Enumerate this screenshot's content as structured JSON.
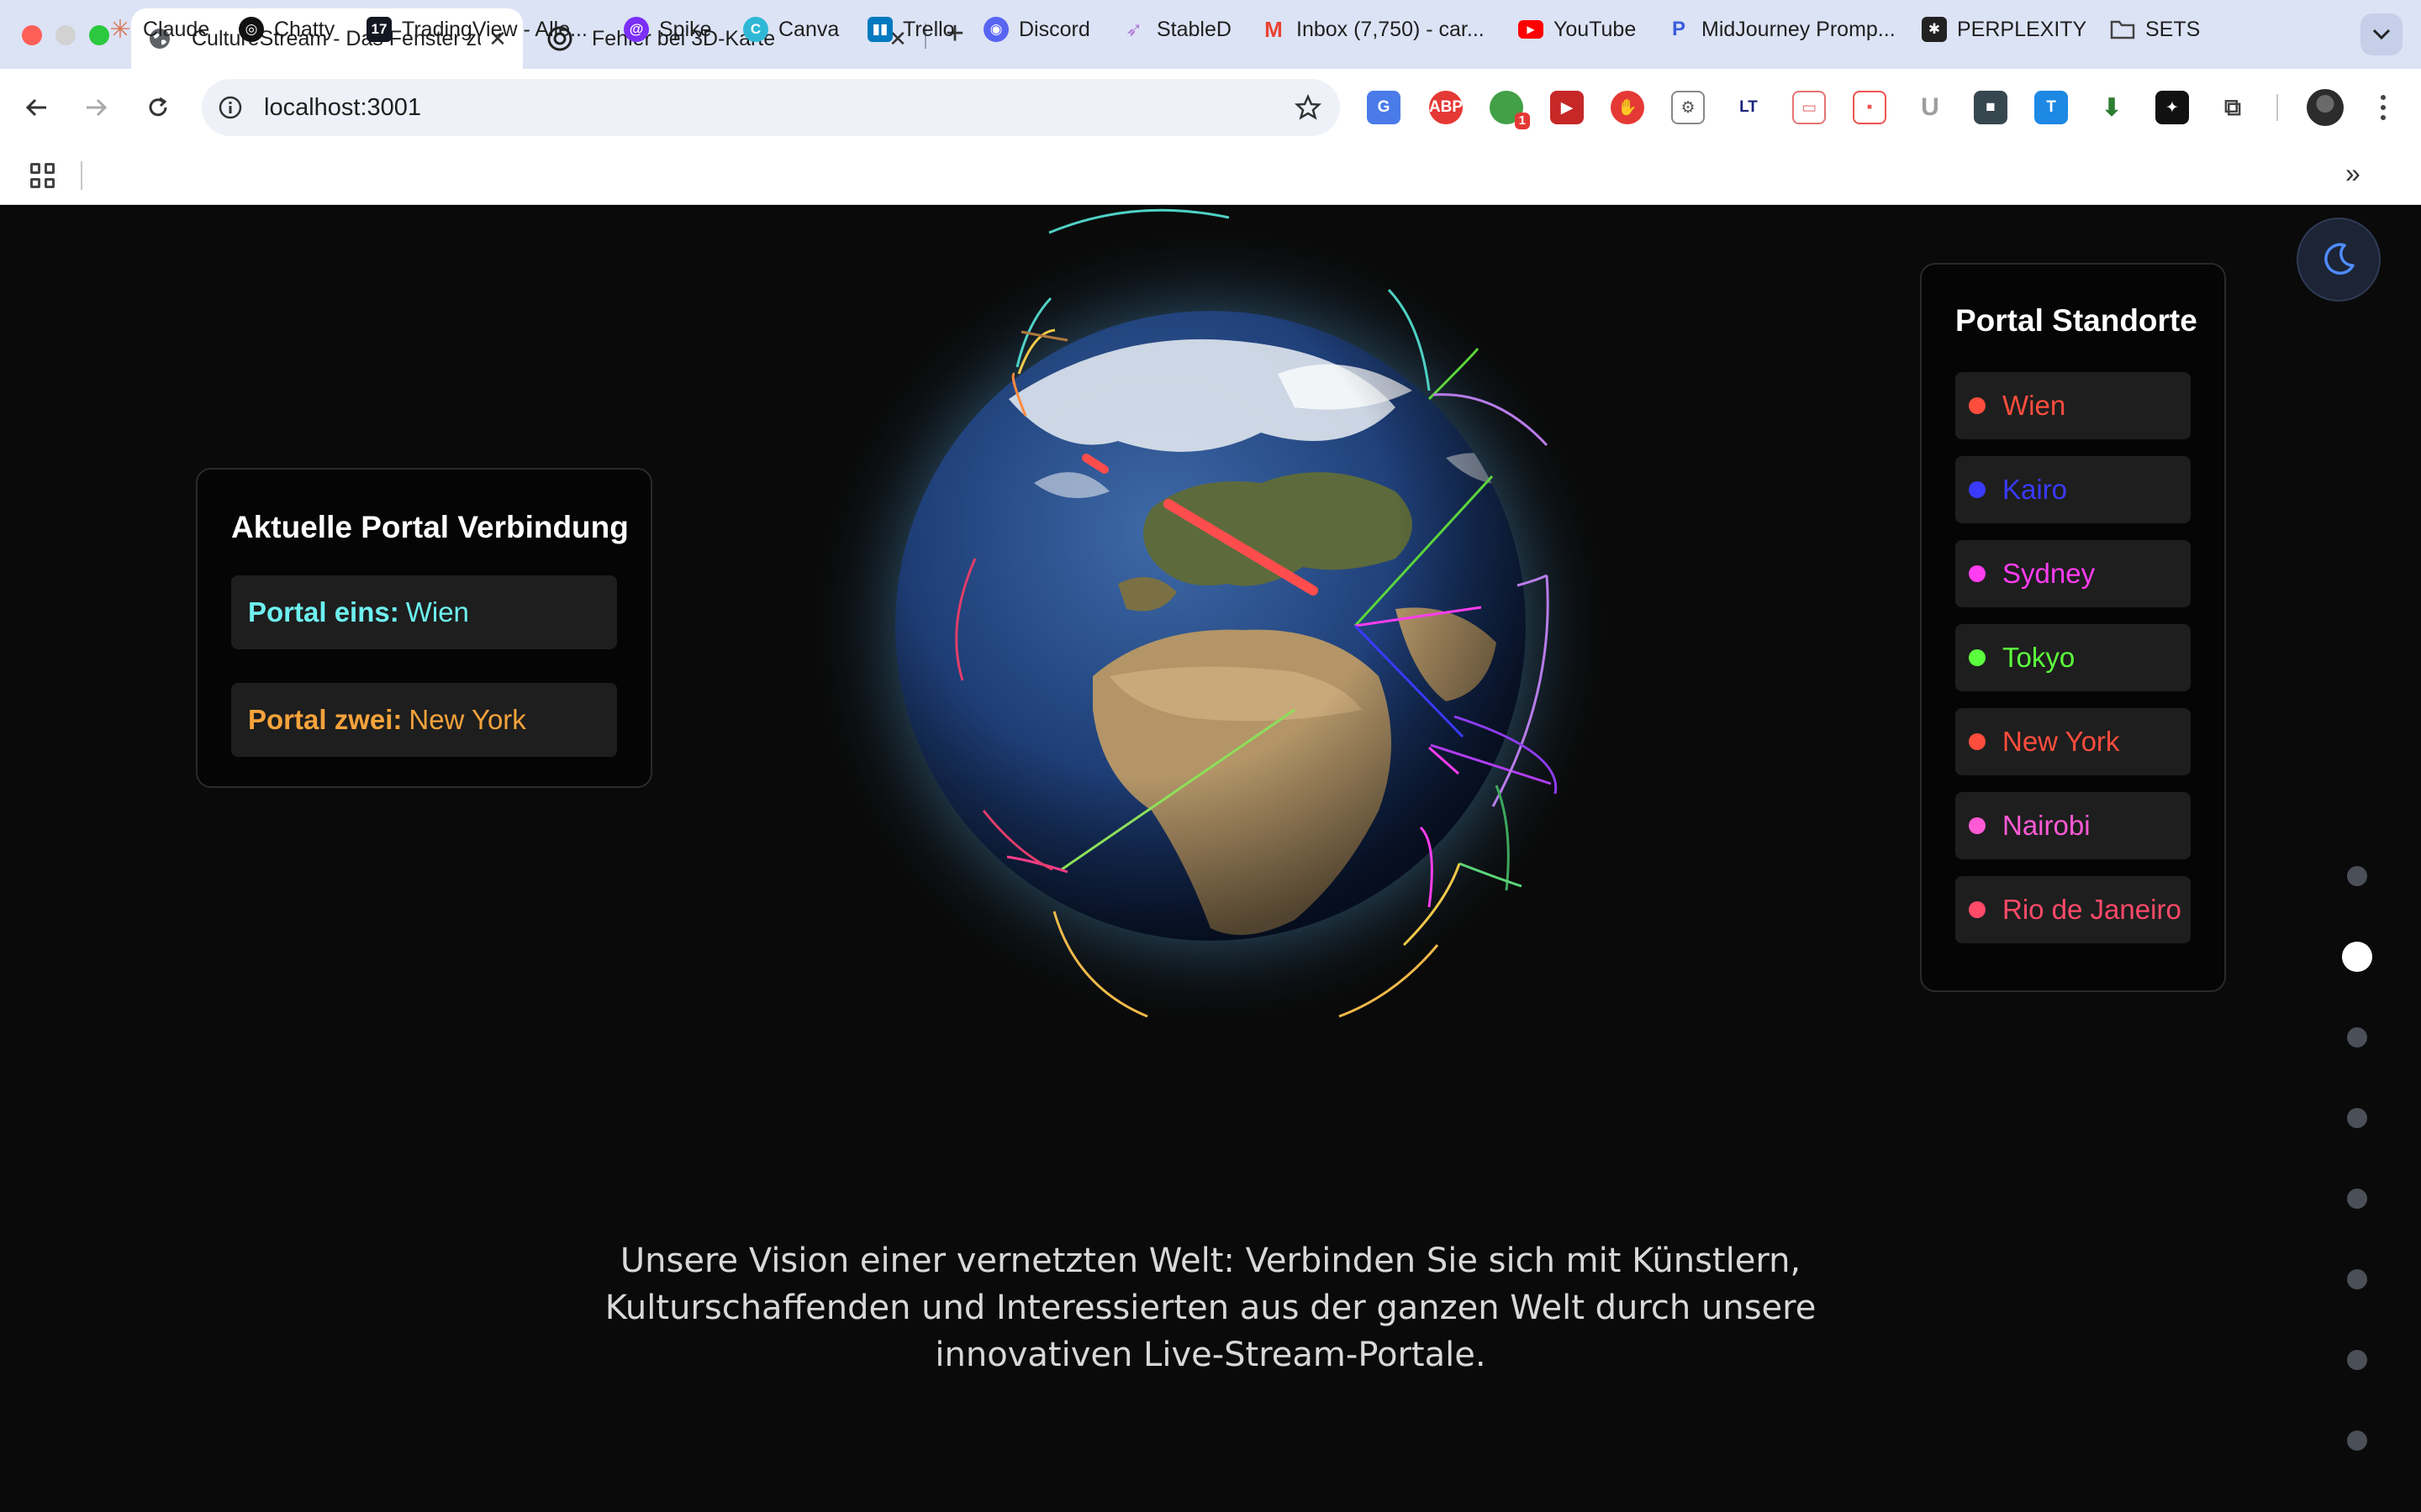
{
  "browser": {
    "tabs": [
      {
        "title": "CultureStream - Das Fenster zur Welt",
        "active": true,
        "icon": "globe-icon"
      },
      {
        "title": "Fehler bei 3D-Karte",
        "active": false,
        "icon": "chatgpt-icon"
      }
    ],
    "url": "localhost:3001",
    "bookmarks": [
      {
        "label": "Claude",
        "icon": "claude-icon",
        "color": "#d97757"
      },
      {
        "label": "Chatty",
        "icon": "chatgpt-icon",
        "color": "#111111"
      },
      {
        "label": "TradingView - Alle...",
        "icon": "tradingview-icon",
        "color": "#131722"
      },
      {
        "label": "Spike",
        "icon": "spike-icon",
        "color": "#7b2ff7"
      },
      {
        "label": "Canva",
        "icon": "canva-icon",
        "color": "#2fb8d6"
      },
      {
        "label": "Trello",
        "icon": "trello-icon",
        "color": "#0079bf"
      },
      {
        "label": "Discord",
        "icon": "discord-icon",
        "color": "#5865f2"
      },
      {
        "label": "StableD",
        "icon": "rocket-icon",
        "color": "#b07cd8"
      },
      {
        "label": "Inbox (7,750) - car...",
        "icon": "gmail-icon",
        "color": "#ea4335"
      },
      {
        "label": "YouTube",
        "icon": "youtube-icon",
        "color": "#ff0000"
      },
      {
        "label": "MidJourney Promp...",
        "icon": "midjourney-icon",
        "color": "#3b5bdb"
      },
      {
        "label": "PERPLEXITY",
        "icon": "perplexity-icon",
        "color": "#222222"
      },
      {
        "label": "SETS",
        "icon": "folder-icon",
        "color": "#444444"
      }
    ],
    "extension_badge": "1"
  },
  "connection_panel": {
    "title": "Aktuelle Portal Verbindung",
    "portal_one_label": "Portal eins:",
    "portal_one_value": "Wien",
    "portal_two_label": "Portal zwei:",
    "portal_two_value": "New York",
    "portal_one_color": "#6ef0f0",
    "portal_two_color": "#f6a33b"
  },
  "locations_panel": {
    "title": "Portal Standorte",
    "locations": [
      {
        "name": "Wien",
        "color": "#ff4d3d"
      },
      {
        "name": "Kairo",
        "color": "#3a3aff"
      },
      {
        "name": "Sydney",
        "color": "#ff3df0"
      },
      {
        "name": "Tokyo",
        "color": "#5cff3d"
      },
      {
        "name": "New York",
        "color": "#ff4d3d"
      },
      {
        "name": "Nairobi",
        "color": "#ff5ad6"
      },
      {
        "name": "Rio de Janeiro",
        "color": "#ff4a68"
      }
    ]
  },
  "theme_toggle": {
    "icon": "moon-icon",
    "color": "#4f8cff"
  },
  "section_nav": {
    "count": 8,
    "active_index": 1
  },
  "vision_text": "Unsere Vision einer vernetzten Welt: Verbinden Sie sich mit Künstlern, Kulturschaffenden und Interessierten aus der ganzen Welt durch unsere innovativen Live-Stream-Portale."
}
